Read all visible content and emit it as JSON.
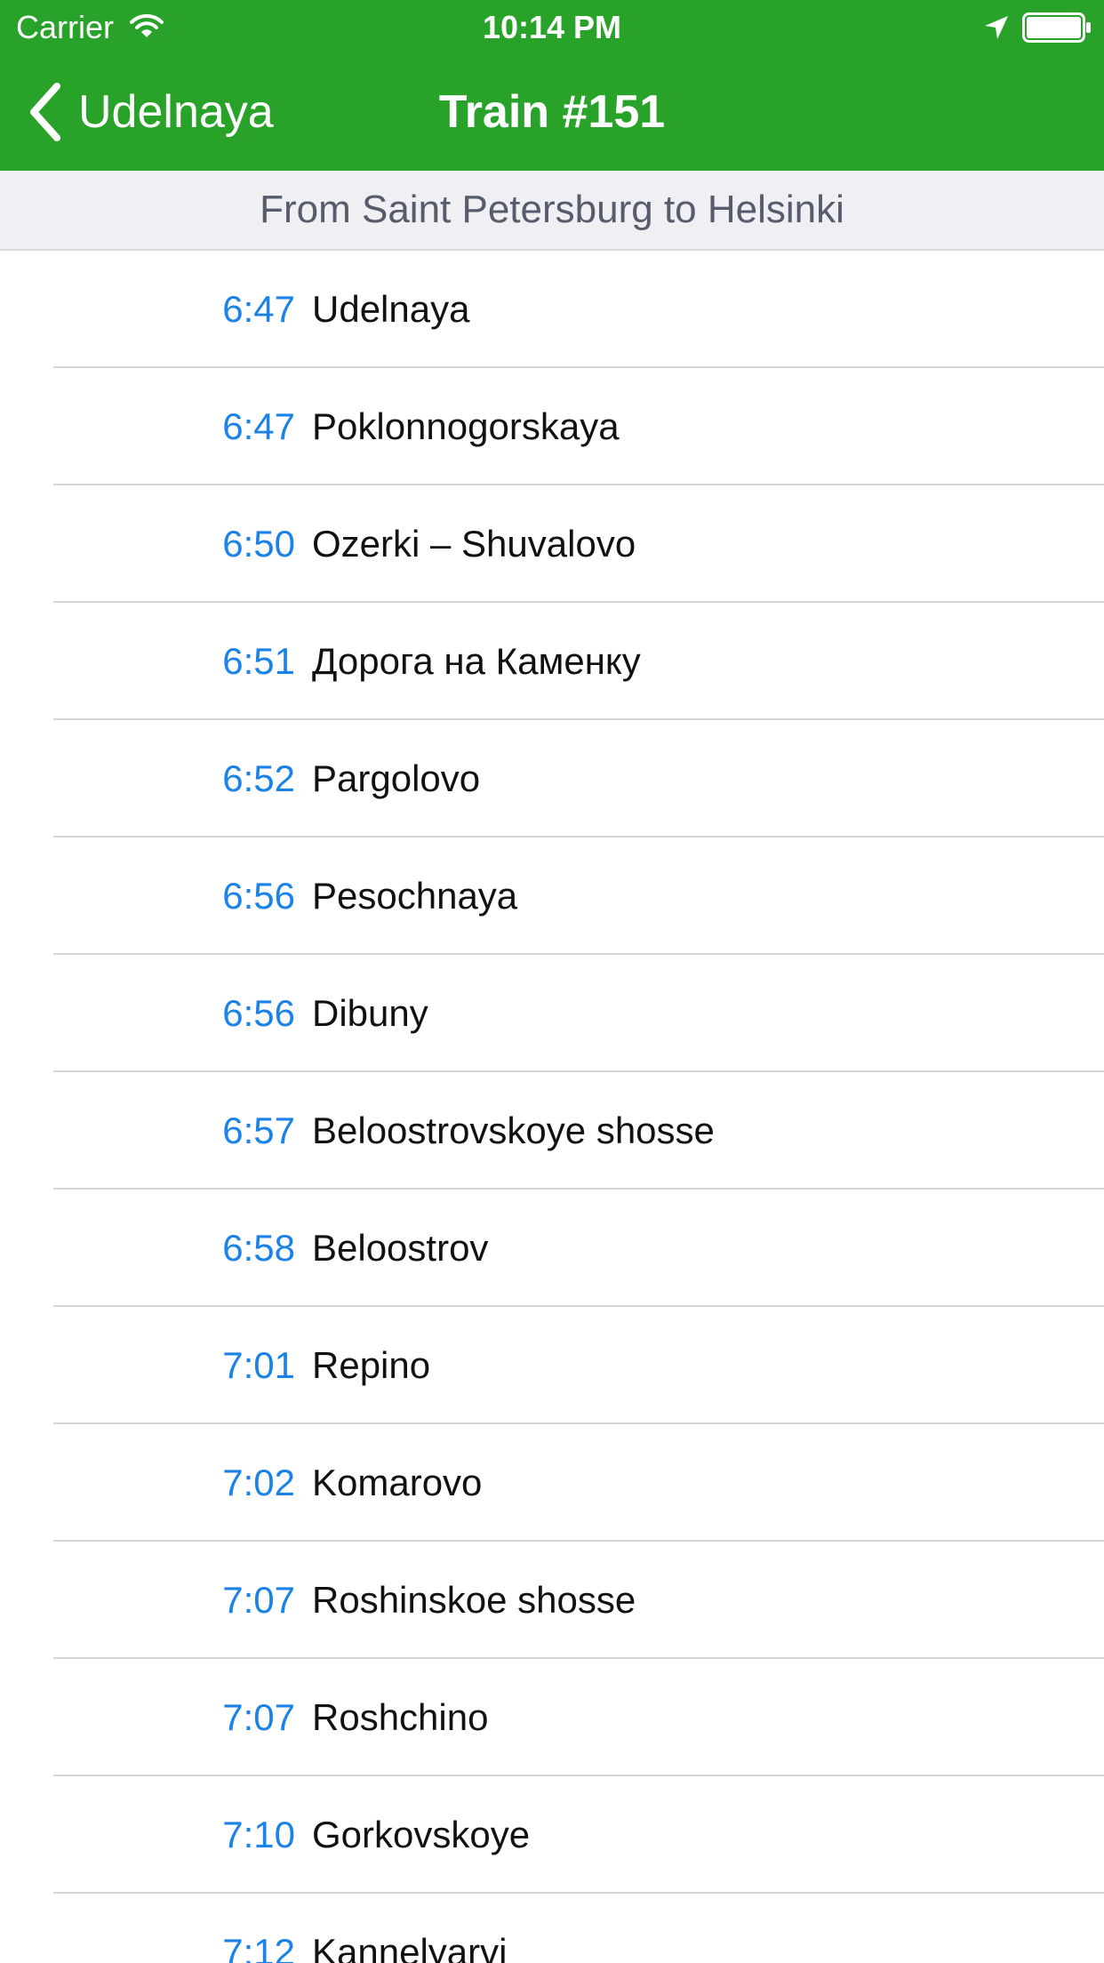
{
  "status_bar": {
    "carrier": "Carrier",
    "time": "10:14 PM",
    "icons": [
      "wifi-icon",
      "location-arrow-icon",
      "battery-icon"
    ]
  },
  "nav_bar": {
    "back_label": "Udelnaya",
    "title": "Train #151"
  },
  "section": {
    "title": "From Saint Petersburg to Helsinki"
  },
  "colors": {
    "nav_background": "#28a229",
    "time_accent": "#1a82e8",
    "section_background": "#efeff4"
  },
  "stops": [
    {
      "time": "6:47",
      "name": "Udelnaya"
    },
    {
      "time": "6:47",
      "name": "Poklonnogorskaya"
    },
    {
      "time": "6:50",
      "name": "Ozerki – Shuvalovo"
    },
    {
      "time": "6:51",
      "name": "Дорога на Каменку"
    },
    {
      "time": "6:52",
      "name": "Pargolovo"
    },
    {
      "time": "6:56",
      "name": "Pesochnaya"
    },
    {
      "time": "6:56",
      "name": "Dibuny"
    },
    {
      "time": "6:57",
      "name": "Beloostrovskoye shosse"
    },
    {
      "time": "6:58",
      "name": "Beloostrov"
    },
    {
      "time": "7:01",
      "name": "Repino"
    },
    {
      "time": "7:02",
      "name": "Komarovo"
    },
    {
      "time": "7:07",
      "name": "Roshinskoe shosse"
    },
    {
      "time": "7:07",
      "name": "Roshchino"
    },
    {
      "time": "7:10",
      "name": "Gorkovskoye"
    },
    {
      "time": "7:12",
      "name": "Kannelyarvi"
    }
  ]
}
